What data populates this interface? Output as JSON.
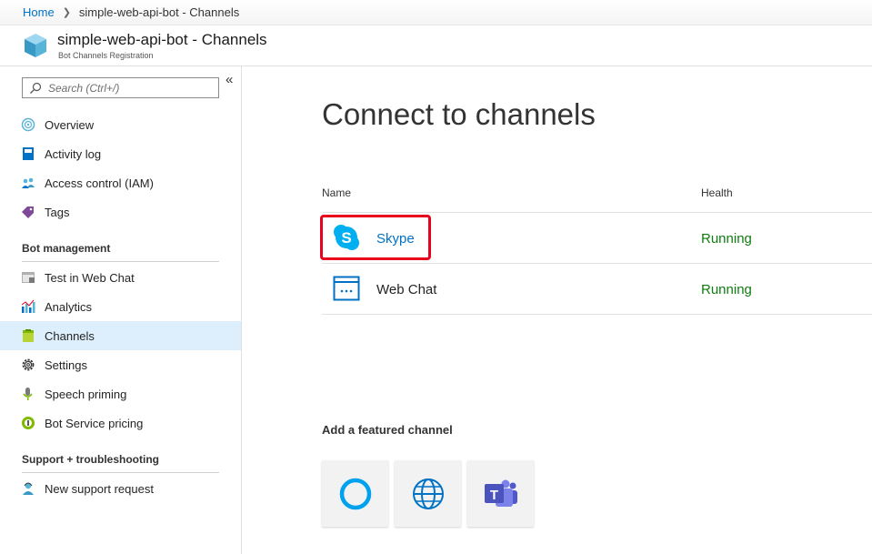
{
  "breadcrumb": {
    "home": "Home",
    "current": "simple-web-api-bot - Channels"
  },
  "header": {
    "title": "simple-web-api-bot - Channels",
    "subtitle": "Bot Channels Registration"
  },
  "sidebar": {
    "search_placeholder": "Search (Ctrl+/)",
    "collapse_label": "«",
    "items": [
      {
        "label": "Overview",
        "icon": "overview-icon"
      },
      {
        "label": "Activity log",
        "icon": "activity-log-icon"
      },
      {
        "label": "Access control (IAM)",
        "icon": "iam-icon"
      },
      {
        "label": "Tags",
        "icon": "tag-icon"
      }
    ],
    "sections": [
      {
        "title": "Bot management",
        "items": [
          {
            "label": "Test in Web Chat",
            "icon": "webchat-test-icon"
          },
          {
            "label": "Analytics",
            "icon": "analytics-icon"
          },
          {
            "label": "Channels",
            "icon": "channels-icon",
            "active": true
          },
          {
            "label": "Settings",
            "icon": "gear-icon"
          },
          {
            "label": "Speech priming",
            "icon": "microphone-icon"
          },
          {
            "label": "Bot Service pricing",
            "icon": "pricing-icon"
          }
        ]
      },
      {
        "title": "Support + troubleshooting",
        "items": [
          {
            "label": "New support request",
            "icon": "support-person-icon"
          }
        ]
      }
    ]
  },
  "main": {
    "title": "Connect to channels",
    "columns": {
      "name": "Name",
      "health": "Health"
    },
    "channels": [
      {
        "name": "Skype",
        "health": "Running",
        "icon": "skype-icon"
      },
      {
        "name": "Web Chat",
        "health": "Running",
        "icon": "webchat-icon"
      }
    ],
    "featured_title": "Add a featured channel",
    "featured": [
      {
        "icon": "cortana-icon"
      },
      {
        "icon": "globe-icon"
      },
      {
        "icon": "teams-icon"
      }
    ]
  },
  "colors": {
    "accent": "#0072c6",
    "running": "#107c10",
    "highlight": "#e8001c",
    "active_nav": "#ddeefc"
  }
}
